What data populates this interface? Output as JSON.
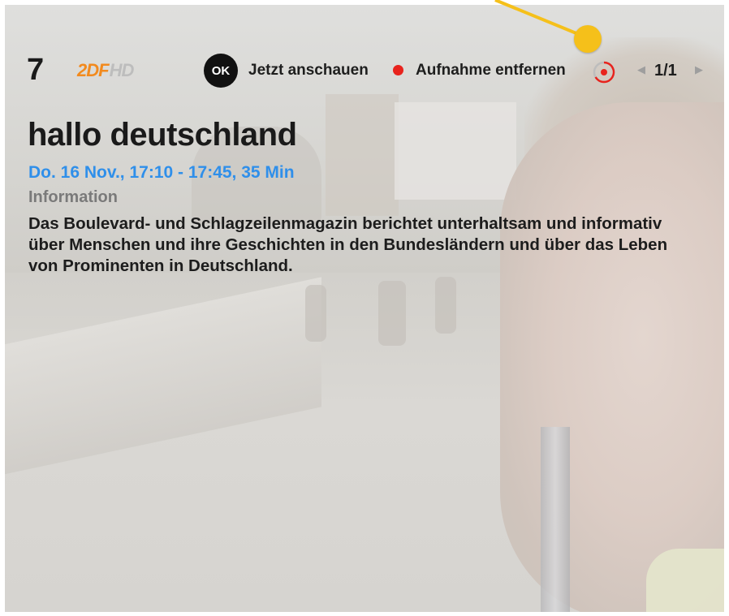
{
  "channel": {
    "number": "7",
    "logo_text": "2DF",
    "logo_hd": "HD"
  },
  "actions": {
    "ok_label": "OK",
    "watch_label": "Jetzt anschauen",
    "remove_recording_label": "Aufnahme entfernen"
  },
  "pager": {
    "text": "1/1"
  },
  "program": {
    "title": "hallo deutschland",
    "datetime": "Do. 16 Nov., 17:10 - 17:45, 35 Min",
    "genre": "Information",
    "description": "Das Boulevard- und Schlagzeilenmagazin berichtet unterhaltsam und informativ über Menschen und ihre Geschichten in den Bundesländern und über das Leben von Prominenten in Deutschland."
  },
  "colors": {
    "accent_blue": "#2f8fea",
    "record_red": "#e8231d",
    "zdf_orange": "#f28a1e",
    "annotation_yellow": "#f5c01a"
  },
  "icons": [
    "ok-button-icon",
    "record-dot-icon",
    "recording-indicator-icon",
    "chevron-left-icon",
    "chevron-right-icon"
  ]
}
